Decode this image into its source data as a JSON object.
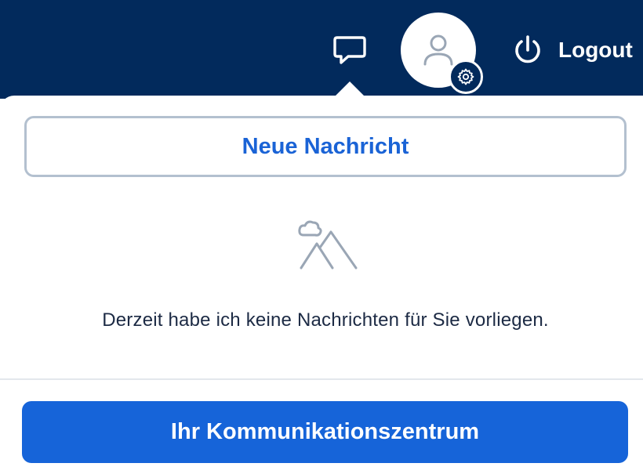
{
  "header": {
    "chat_icon": "chat-bubble-icon",
    "avatar_icon": "user-icon",
    "settings_icon": "gear-icon",
    "logout_icon": "power-icon",
    "logout_label": "Logout"
  },
  "messages_panel": {
    "new_message_label": "Neue Nachricht",
    "empty_icon": "empty-landscape-icon",
    "empty_text": "Derzeit habe ich keine Nachrichten für Sie vorliegen.",
    "communication_center_label": "Ihr Kommunikationszentrum"
  },
  "colors": {
    "header_bg": "#022a5c",
    "primary": "#1664d9",
    "link_text": "#1a63d6",
    "border": "#b3c0cf",
    "text": "#1c2a44",
    "icon_gray": "#9aa6b5"
  }
}
